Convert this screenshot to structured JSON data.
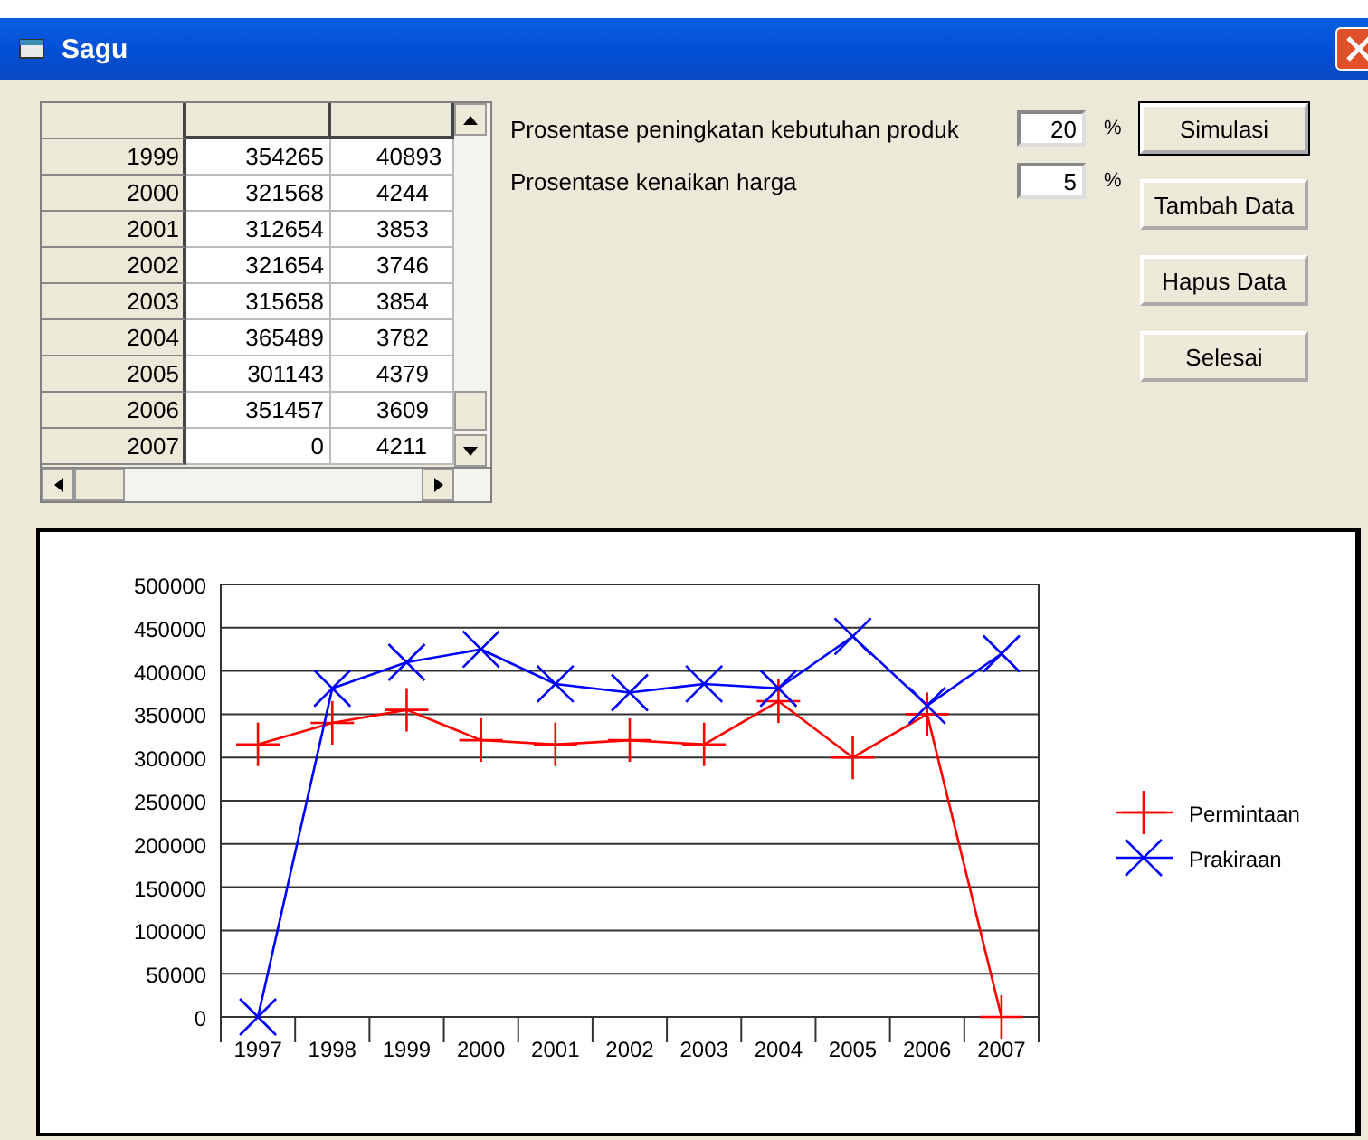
{
  "window": {
    "title": "Sagu"
  },
  "table": {
    "rows": [
      {
        "header": "1999",
        "cells": [
          "354265",
          "40893"
        ]
      },
      {
        "header": "2000",
        "cells": [
          "321568",
          "4244"
        ]
      },
      {
        "header": "2001",
        "cells": [
          "312654",
          "3853"
        ]
      },
      {
        "header": "2002",
        "cells": [
          "321654",
          "3746"
        ]
      },
      {
        "header": "2003",
        "cells": [
          "315658",
          "3854"
        ]
      },
      {
        "header": "2004",
        "cells": [
          "365489",
          "3782"
        ]
      },
      {
        "header": "2005",
        "cells": [
          "301143",
          "4379"
        ]
      },
      {
        "header": "2006",
        "cells": [
          "351457",
          "3609"
        ]
      },
      {
        "header": "2007",
        "cells": [
          "0",
          "4211"
        ]
      }
    ]
  },
  "fields": [
    {
      "label": "Prosentase peningkatan kebutuhan produk",
      "value": "20",
      "unit": "%"
    },
    {
      "label": "Prosentase kenaikan harga",
      "value": "5",
      "unit": "%"
    }
  ],
  "buttons": [
    {
      "label": "Simulasi",
      "default": true
    },
    {
      "label": "Tambah Data",
      "default": false
    },
    {
      "label": "Hapus Data",
      "default": false
    },
    {
      "label": "Selesai",
      "default": false
    }
  ],
  "chart": {
    "chart_data": {
      "type": "line",
      "categories": [
        "1997",
        "1998",
        "1999",
        "2000",
        "2001",
        "2002",
        "2003",
        "2004",
        "2005",
        "2006",
        "2007"
      ],
      "ylim": [
        0,
        500000
      ],
      "yticks": [
        0,
        50000,
        100000,
        150000,
        200000,
        250000,
        300000,
        350000,
        400000,
        450000,
        500000
      ],
      "grid": true,
      "legend": true,
      "series": [
        {
          "name": "Permintaan",
          "color": "#ff0000",
          "values": [
            315000,
            340000,
            355000,
            320000,
            315000,
            320000,
            315000,
            365000,
            300000,
            350000,
            0
          ]
        },
        {
          "name": "Prakiraan",
          "color": "#0000ff",
          "marker": "cross",
          "values": [
            0,
            380000,
            410000,
            425000,
            385000,
            375000,
            385000,
            380000,
            440000,
            360000,
            420000
          ]
        }
      ]
    }
  }
}
